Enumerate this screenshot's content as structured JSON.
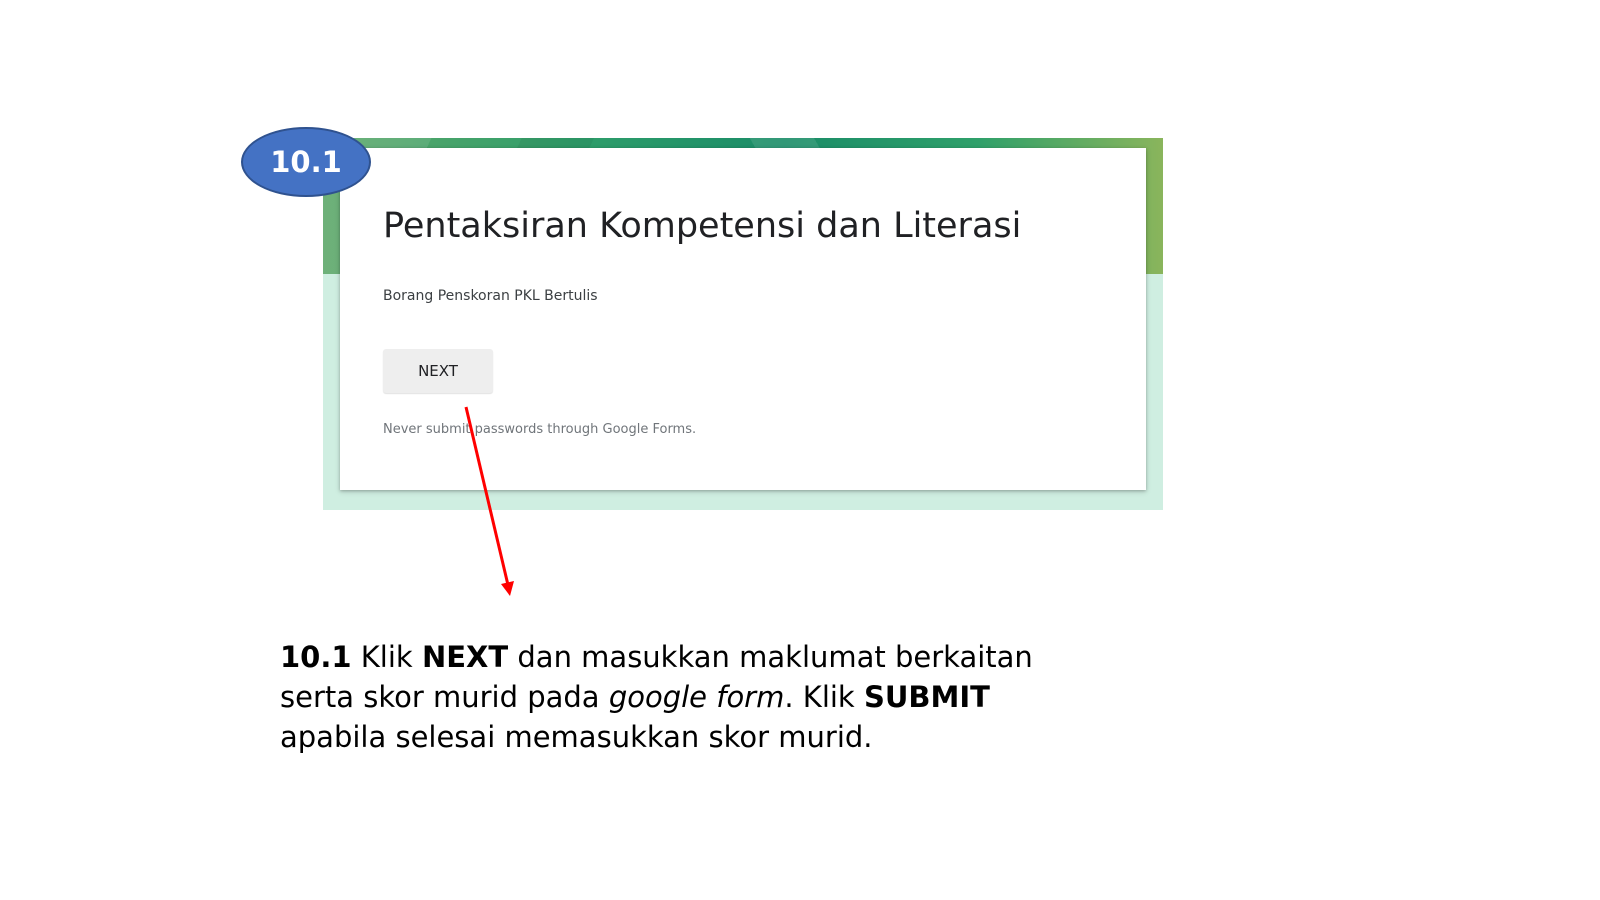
{
  "step_badge": {
    "label": "10.1",
    "color": "#4472c4"
  },
  "form": {
    "title": "Pentaksiran Kompetensi dan Literasi",
    "description": "Borang Penskoran PKL Bertulis",
    "next_button": "NEXT",
    "warning": "Never submit passwords through Google Forms.",
    "theme_color": "#1a8c68",
    "background_color": "#cfeee1"
  },
  "annotation": {
    "arrow_color": "#ff0000"
  },
  "instruction": {
    "step": "10.1",
    "t1": " Klik ",
    "next": "NEXT",
    "t2": " dan masukkan maklumat berkaitan serta skor murid pada ",
    "google_form": "google form",
    "t3": ". Klik ",
    "submit": "SUBMIT",
    "t4": " apabila selesai memasukkan skor murid."
  }
}
